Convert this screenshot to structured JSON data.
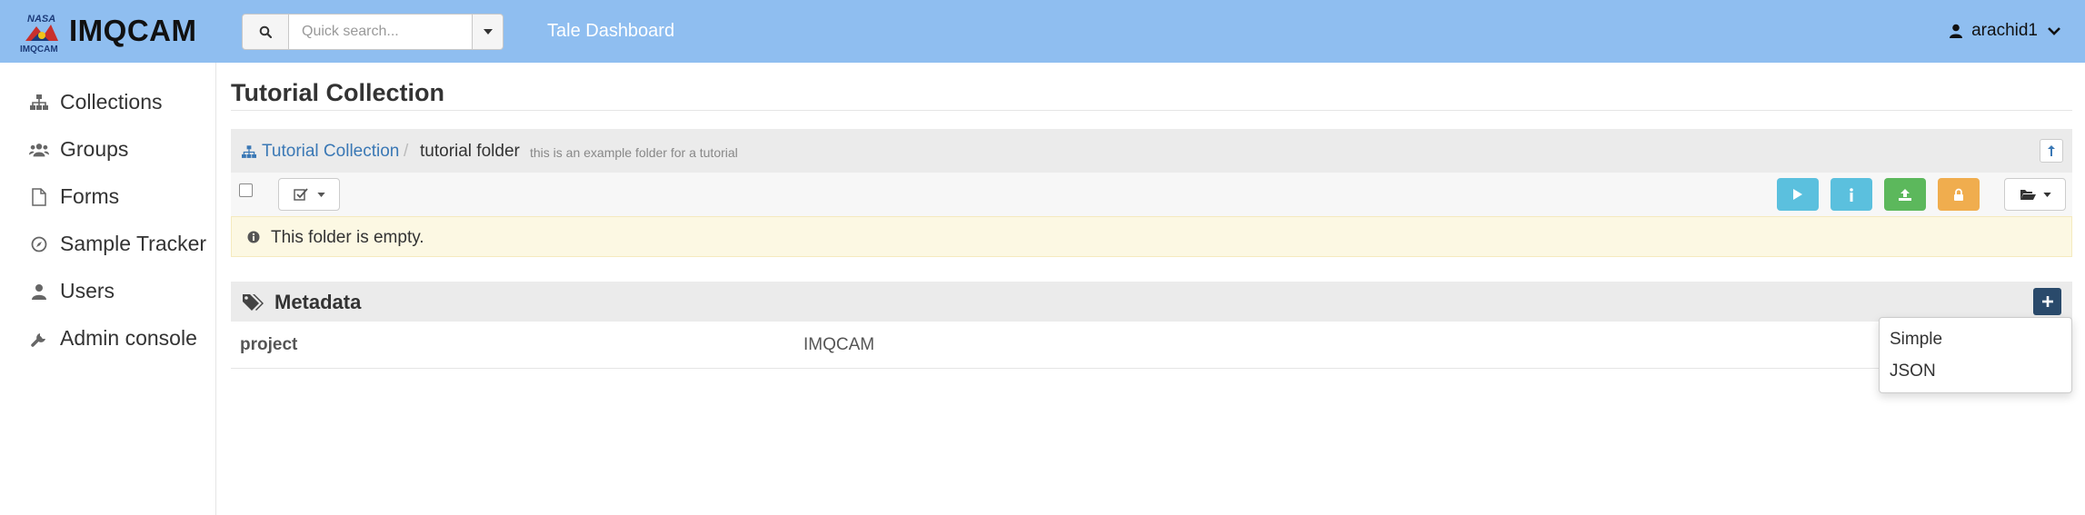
{
  "header": {
    "logo_small_top": "NASA",
    "logo_small_bottom": "IMQCAM",
    "app_name": "IMQCAM",
    "search_placeholder": "Quick search...",
    "nav_link": "Tale Dashboard",
    "user_name": "arachid1",
    "colors": {
      "header_bg": "#8fbef0"
    }
  },
  "sidebar": {
    "items": [
      {
        "label": "Collections",
        "icon": "sitemap-icon"
      },
      {
        "label": "Groups",
        "icon": "users-icon"
      },
      {
        "label": "Forms",
        "icon": "file-icon"
      },
      {
        "label": "Sample Tracker",
        "icon": "compass-icon"
      },
      {
        "label": "Users",
        "icon": "user-icon"
      },
      {
        "label": "Admin console",
        "icon": "wrench-icon"
      }
    ]
  },
  "main": {
    "title": "Tutorial Collection",
    "breadcrumb": {
      "root": "Tutorial Collection",
      "separator": "/",
      "current": "tutorial folder",
      "description": "this is an example folder for a tutorial"
    },
    "empty_message": "This folder is empty.",
    "metadata": {
      "heading": "Metadata",
      "rows": [
        {
          "key": "project",
          "value": "IMQCAM"
        }
      ],
      "add_menu": [
        "Simple",
        "JSON"
      ]
    },
    "colors": {
      "run": "#5bc0de",
      "info": "#5bc0de",
      "upload": "#5cb85c",
      "lock": "#f0ad4e",
      "metadata_add": "#2a4a6b",
      "link": "#3a78b5",
      "alert_bg": "#fcf8e3"
    }
  }
}
